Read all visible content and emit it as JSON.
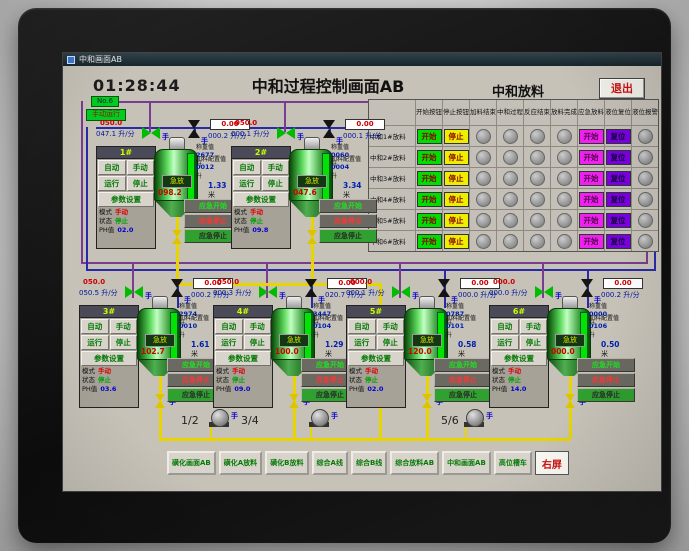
{
  "window": {
    "titlebar": "中和画面AB",
    "clock": "01:28:44",
    "title": "中和过程控制画面AB",
    "exit_label": "退出"
  },
  "badges": {
    "badge1": "No.6",
    "badge2": "手动运行"
  },
  "discharge_table": {
    "title": "中和放料",
    "columns": [
      "开始按钮",
      "停止按钮",
      "加料结束",
      "中和过程",
      "反应结束",
      "放料完成",
      "应急放料",
      "液位复位",
      "液位报警"
    ],
    "rows": [
      {
        "label": "中和1#放料",
        "start": "开始",
        "stop": "停止",
        "emergency": "开始",
        "reset": "复位"
      },
      {
        "label": "中和2#放料",
        "start": "开始",
        "stop": "停止",
        "emergency": "开始",
        "reset": "复位"
      },
      {
        "label": "中和3#放料",
        "start": "开始",
        "stop": "停止",
        "emergency": "开始",
        "reset": "复位"
      },
      {
        "label": "中和4#放料",
        "start": "开始",
        "stop": "停止",
        "emergency": "开始",
        "reset": "复位"
      },
      {
        "label": "中和5#放料",
        "start": "开始",
        "stop": "停止",
        "emergency": "开始",
        "reset": "复位"
      },
      {
        "label": "中和6#放料",
        "start": "开始",
        "stop": "停止",
        "emergency": "开始",
        "reset": "复位"
      }
    ]
  },
  "tank_common": {
    "auto": "自动",
    "manual": "手动",
    "run": "运行",
    "stop": "停止",
    "params": "参数设置",
    "mode_label": "模式",
    "status_label": "状态",
    "ph_label": "PH值",
    "weight_label": "称重值",
    "config_label": "加料配置值",
    "em_start": "应急开始",
    "em_stop": "应急停止",
    "em_stop2": "应急停止",
    "hand": "手",
    "flow_unit": "升/分",
    "volume_unit": "升",
    "level_unit": "米",
    "tank_button": "急放"
  },
  "tanks": [
    {
      "id": "1#",
      "left_setpoint": "050.0",
      "left_flow": "047.1",
      "right_setpoint": "0.00",
      "right_flow": "000.2",
      "mode": "手动",
      "status": "停止",
      "ph": "02.0",
      "tank_value": "098.2",
      "weight": "2677",
      "config": "0012",
      "level": "1.33"
    },
    {
      "id": "2#",
      "left_setpoint": "050.0",
      "left_flow": "000.1",
      "right_setpoint": "0.00",
      "right_flow": "000.1",
      "mode": "手动",
      "status": "停止",
      "ph": "09.8",
      "tank_value": "047.6",
      "weight": "0060",
      "config": "0004",
      "level": "3.34"
    },
    {
      "id": "3#",
      "left_setpoint": "050.0",
      "left_flow": "050.5",
      "right_setpoint": "0.00",
      "right_flow": "000.2",
      "mode": "手动",
      "status": "停止",
      "ph": "03.6",
      "tank_value": "102.7",
      "weight": "2974",
      "config": "0010",
      "level": "1.61"
    },
    {
      "id": "4#",
      "left_setpoint": "050.0",
      "left_flow": "000.3",
      "right_setpoint": "0.00",
      "right_flow": "020.7",
      "mode": "手动",
      "status": "停止",
      "ph": "09.0",
      "tank_value": "100.0",
      "weight": "3447",
      "config": "0104",
      "level": "1.29"
    },
    {
      "id": "5#",
      "left_setpoint": "000.0",
      "left_flow": "000.1",
      "right_setpoint": "0.00",
      "right_flow": "000.0",
      "mode": "手动",
      "status": "停止",
      "ph": "02.0",
      "tank_value": "120.0",
      "weight": "0787",
      "config": "0101",
      "level": "0.58"
    },
    {
      "id": "6#",
      "left_setpoint": "000.0",
      "left_flow": "000.0",
      "right_setpoint": "0.00",
      "right_flow": "000.2",
      "mode": "手动",
      "status": "停止",
      "ph": "14.0",
      "tank_value": "000.0",
      "weight": "0000",
      "config": "0106",
      "level": "0.50"
    }
  ],
  "pumps": [
    {
      "label": "1/2"
    },
    {
      "label": "3/4"
    },
    {
      "label": "5/6"
    }
  ],
  "bottom_buttons": [
    "磺化画面AB",
    "磺化A放料",
    "磺化B放料",
    "综合A线",
    "综合B线",
    "综合放料AB",
    "中和画面AB",
    "高位槽车"
  ],
  "right_screen_button": "右屏",
  "colors": {
    "start_green": "#00dd00",
    "stop_yellow": "#eeee00",
    "emergency_magenta": "#ee22ee",
    "reset_purple": "#7a00e0",
    "pipe_purple": "#7a3c8e",
    "pipe_blue": "#2a2aa8",
    "pipe_yellow": "#e8d400",
    "lamp_gray": "#9a9a9a"
  }
}
